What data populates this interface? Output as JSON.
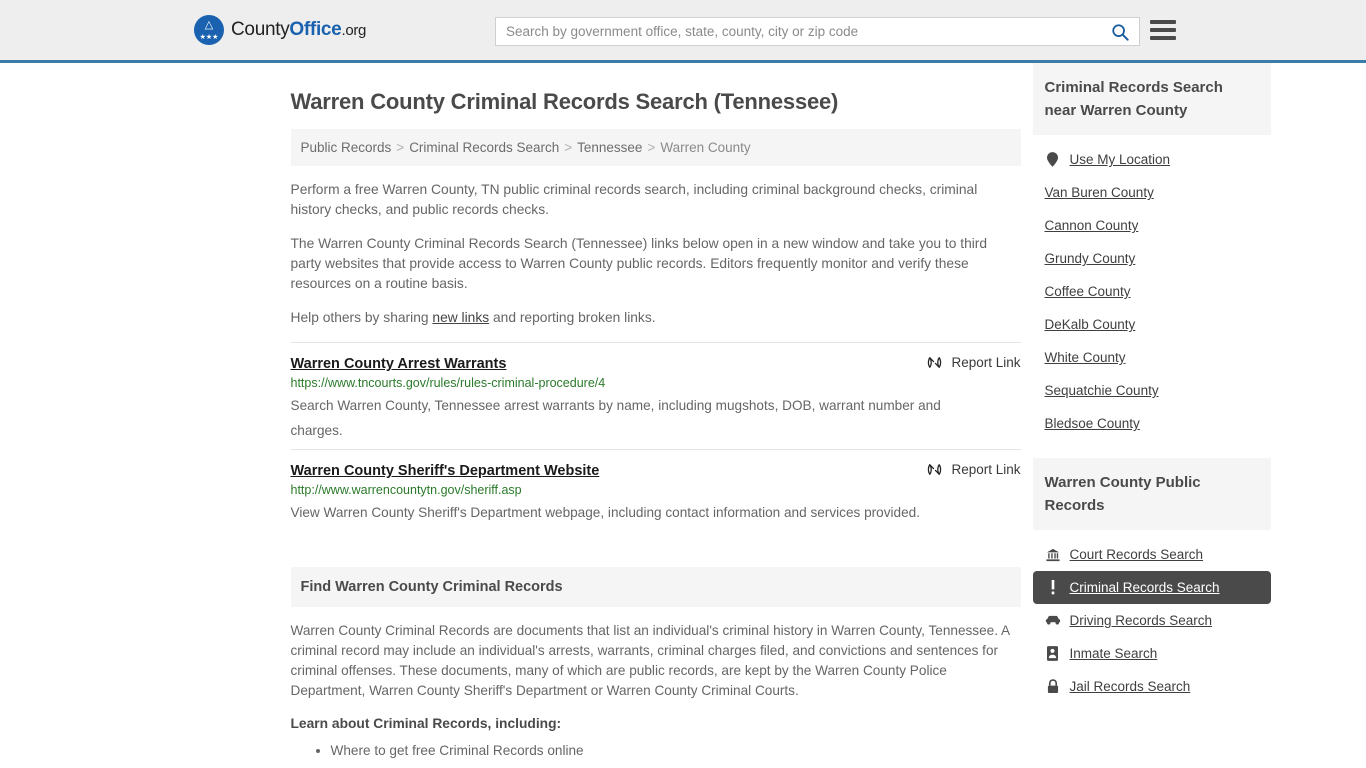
{
  "header": {
    "logo": {
      "part1": "County",
      "part2": "Office",
      "part3": ".org",
      "icon": "eagle-shield-icon"
    },
    "search": {
      "placeholder": "Search by government office, state, county, city or zip code",
      "value": "",
      "button_icon": "search-icon"
    },
    "menu_icon": "hamburger-menu-icon",
    "accent_color": "#3d7ca8"
  },
  "main": {
    "title": "Warren County Criminal Records Search (Tennessee)",
    "breadcrumb": [
      {
        "label": "Public Records",
        "current": false
      },
      {
        "label": "Criminal Records Search",
        "current": false
      },
      {
        "label": "Tennessee",
        "current": false
      },
      {
        "label": "Warren County",
        "current": true
      }
    ],
    "breadcrumb_separator": ">",
    "intro_p1": "Perform a free Warren County, TN public criminal records search, including criminal background checks, criminal history checks, and public records checks.",
    "intro_p2": "The Warren County Criminal Records Search (Tennessee) links below open in a new window and take you to third party websites that provide access to Warren County public records. Editors frequently monitor and verify these resources on a routine basis.",
    "intro_p3_before": "Help others by sharing ",
    "intro_p3_link": "new links",
    "intro_p3_after": " and reporting broken links.",
    "report_link_label": "Report Link",
    "report_link_icon": "broken-link-icon",
    "links": [
      {
        "title": "Warren County Arrest Warrants",
        "url": "https://www.tncourts.gov/rules/rules-criminal-procedure/4",
        "description": "Search Warren County, Tennessee arrest warrants by name, including mugshots, DOB, warrant number and charges."
      },
      {
        "title": "Warren County Sheriff's Department Website",
        "url": "http://www.warrencountytn.gov/sheriff.asp",
        "description": "View Warren County Sheriff's Department webpage, including contact information and services provided."
      }
    ],
    "find_section": {
      "heading": "Find Warren County Criminal Records",
      "body": "Warren County Criminal Records are documents that list an individual's criminal history in Warren County, Tennessee. A criminal record may include an individual's arrests, warrants, criminal charges filed, and convictions and sentences for criminal offenses. These documents, many of which are public records, are kept by the Warren County Police Department, Warren County Sheriff's Department or Warren County Criminal Courts.",
      "learn_heading": "Learn about Criminal Records, including:",
      "learn_items": [
        "Where to get free Criminal Records online"
      ]
    }
  },
  "sidebar": {
    "nearby": {
      "heading": "Criminal Records Search near Warren County",
      "items": [
        {
          "label": "Use My Location",
          "icon": "map-pin-icon",
          "has_icon": true,
          "active": false
        },
        {
          "label": "Van Buren County",
          "icon": "",
          "has_icon": false,
          "active": false
        },
        {
          "label": "Cannon County",
          "icon": "",
          "has_icon": false,
          "active": false
        },
        {
          "label": "Grundy County",
          "icon": "",
          "has_icon": false,
          "active": false
        },
        {
          "label": "Coffee County",
          "icon": "",
          "has_icon": false,
          "active": false
        },
        {
          "label": "DeKalb County",
          "icon": "",
          "has_icon": false,
          "active": false
        },
        {
          "label": "White County",
          "icon": "",
          "has_icon": false,
          "active": false
        },
        {
          "label": "Sequatchie County",
          "icon": "",
          "has_icon": false,
          "active": false
        },
        {
          "label": "Bledsoe County",
          "icon": "",
          "has_icon": false,
          "active": false
        }
      ]
    },
    "public_records": {
      "heading": "Warren County Public Records",
      "items": [
        {
          "label": "Court Records Search",
          "icon": "courthouse-icon",
          "has_icon": true,
          "active": false
        },
        {
          "label": "Criminal Records Search",
          "icon": "exclamation-icon",
          "has_icon": true,
          "active": true
        },
        {
          "label": "Driving Records Search",
          "icon": "car-icon",
          "has_icon": true,
          "active": false
        },
        {
          "label": "Inmate Search",
          "icon": "id-card-icon",
          "has_icon": true,
          "active": false
        },
        {
          "label": "Jail Records Search",
          "icon": "lock-icon",
          "has_icon": true,
          "active": false
        }
      ]
    },
    "active_bg_color": "#4a4a4a",
    "heading_bg_color": "#f5f5f5"
  }
}
